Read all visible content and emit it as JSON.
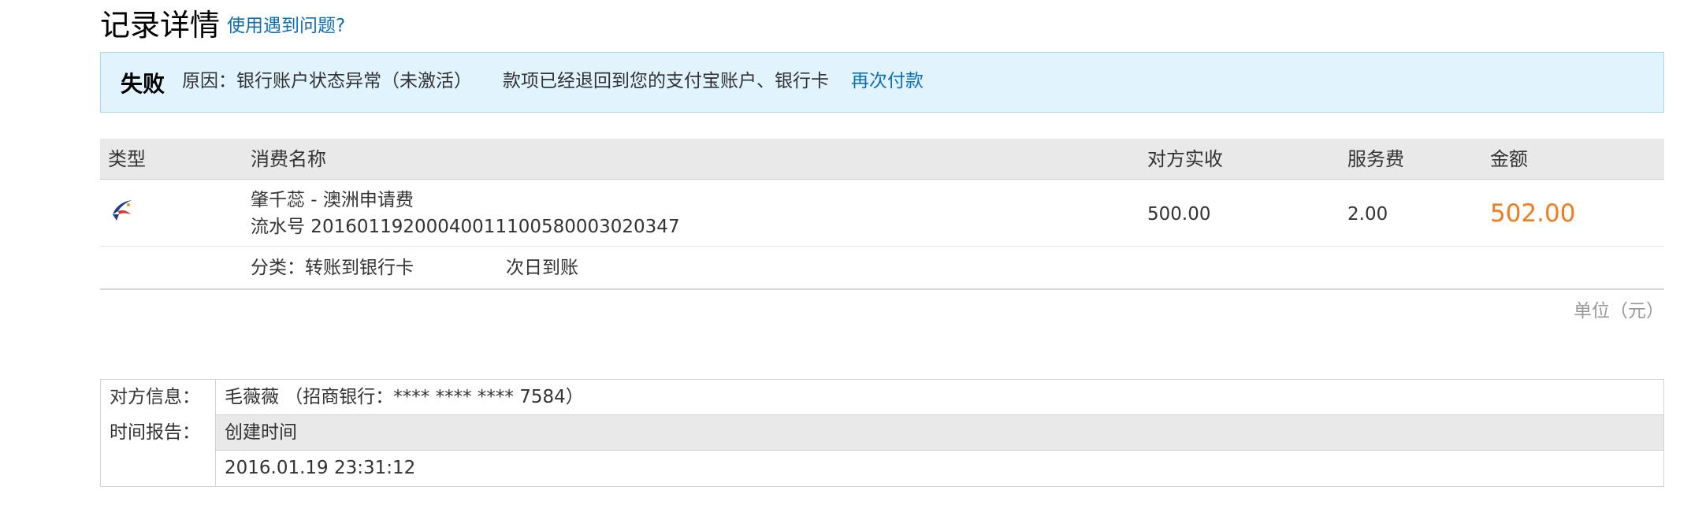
{
  "header": {
    "title": "记录详情",
    "help_link": "使用遇到问题?"
  },
  "alert": {
    "status": "失败",
    "reason": "原因：银行账户状态异常（未激活）",
    "refund_note": "款项已经退回到您的支付宝账户、银行卡",
    "repay_link": "再次付款",
    "background_color": "#e1f4fd",
    "border_color": "#a3d8f3"
  },
  "transactions": {
    "columns": [
      "类型",
      "消费名称",
      "对方实收",
      "服务费",
      "金额"
    ],
    "rows": [
      {
        "type_icon": "transfer-swallow-icon",
        "name": "肇千蕊 - 澳洲申请费",
        "serial": "流水号 20160119200040011100580003020347",
        "received": "500.00",
        "service_fee": "2.00",
        "amount": "502.00",
        "category": "分类：转账到银行卡",
        "arrival": "次日到账"
      }
    ],
    "unit_note": "单位（元）",
    "amount_color": "#f37b1d"
  },
  "info": {
    "counterparty_label": "对方信息：",
    "counterparty_value": "毛薇薇 （招商银行：**** **** **** 7584）",
    "time_label": "时间报告：",
    "time_header": "创建时间",
    "time_value": "2016.01.19 23:31:12"
  },
  "colors": {
    "link": "#0b6fb8",
    "header_bg": "#e9e9e9"
  }
}
